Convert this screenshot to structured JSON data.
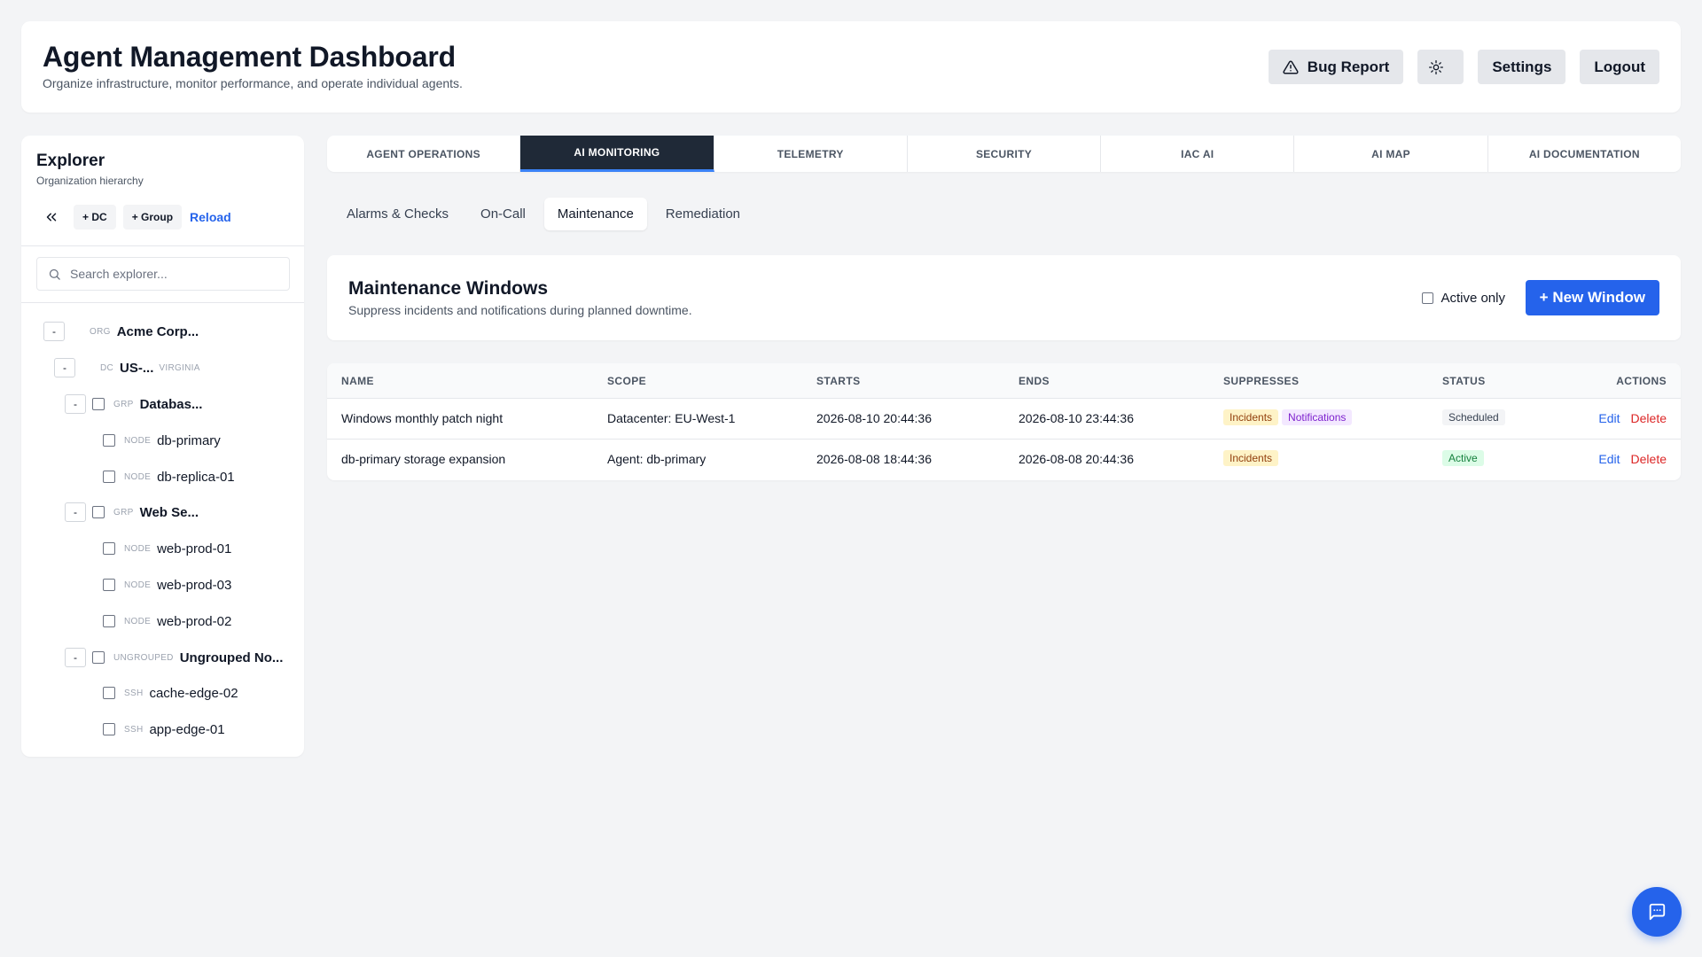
{
  "header": {
    "title": "Agent Management Dashboard",
    "subtitle": "Organize infrastructure, monitor performance, and operate individual agents.",
    "bug_report": "Bug Report",
    "settings": "Settings",
    "logout": "Logout"
  },
  "sidebar": {
    "title": "Explorer",
    "subtitle": "Organization hierarchy",
    "add_dc": "+ DC",
    "add_group": "+ Group",
    "reload": "Reload",
    "search_placeholder": "Search explorer...",
    "tree": [
      {
        "toggle": "-",
        "type": "ORG",
        "name": "Acme Corp...",
        "suffix": ""
      },
      {
        "toggle": "-",
        "type": "DC",
        "name": "US-...",
        "suffix": "VIRGINIA"
      },
      {
        "toggle": "-",
        "type": "GRP",
        "name": "Databas...",
        "suffix": ""
      },
      {
        "toggle": "",
        "type": "NODE",
        "name": "db-primary",
        "suffix": ""
      },
      {
        "toggle": "",
        "type": "NODE",
        "name": "db-replica-01",
        "suffix": ""
      },
      {
        "toggle": "-",
        "type": "GRP",
        "name": "Web Se...",
        "suffix": ""
      },
      {
        "toggle": "",
        "type": "NODE",
        "name": "web-prod-01",
        "suffix": ""
      },
      {
        "toggle": "",
        "type": "NODE",
        "name": "web-prod-03",
        "suffix": ""
      },
      {
        "toggle": "",
        "type": "NODE",
        "name": "web-prod-02",
        "suffix": ""
      },
      {
        "toggle": "-",
        "type": "UNGROUPED",
        "name": "Ungrouped No...",
        "suffix": ""
      },
      {
        "toggle": "",
        "type": "SSH",
        "name": "cache-edge-02",
        "suffix": ""
      },
      {
        "toggle": "",
        "type": "SSH",
        "name": "app-edge-01",
        "suffix": ""
      }
    ]
  },
  "tabs": [
    "AGENT OPERATIONS",
    "AI MONITORING",
    "TELEMETRY",
    "SECURITY",
    "IAC AI",
    "AI MAP",
    "AI DOCUMENTATION"
  ],
  "active_tab": "AI MONITORING",
  "subtabs": [
    "Alarms & Checks",
    "On-Call",
    "Maintenance",
    "Remediation"
  ],
  "active_subtab": "Maintenance",
  "maintenance": {
    "title": "Maintenance Windows",
    "subtitle": "Suppress incidents and notifications during planned downtime.",
    "active_only": "Active only",
    "new_window": "+ New Window"
  },
  "table": {
    "columns": [
      "NAME",
      "SCOPE",
      "STARTS",
      "ENDS",
      "SUPPRESSES",
      "STATUS",
      "ACTIONS"
    ],
    "rows": [
      {
        "name": "Windows monthly patch night",
        "scope": "Datacenter: EU-West-1",
        "starts": "2026-08-10 20:44:36",
        "ends": "2026-08-10 23:44:36",
        "suppresses": [
          "Incidents",
          "Notifications"
        ],
        "status": "Scheduled",
        "edit": "Edit",
        "delete": "Delete"
      },
      {
        "name": "db-primary storage expansion",
        "scope": "Agent: db-primary",
        "starts": "2026-08-08 18:44:36",
        "ends": "2026-08-08 20:44:36",
        "suppresses": [
          "Incidents"
        ],
        "status": "Active",
        "edit": "Edit",
        "delete": "Delete"
      }
    ]
  },
  "colors": {
    "accent": "#2563eb",
    "active_tab_bg": "#1f2937",
    "danger": "#dc2626"
  },
  "icons": {
    "bug_report": "warning-triangle-icon",
    "theme": "sun-icon",
    "collapse": "double-chevron-left-icon",
    "search": "search-icon",
    "chat": "chat-bubble-icon"
  }
}
